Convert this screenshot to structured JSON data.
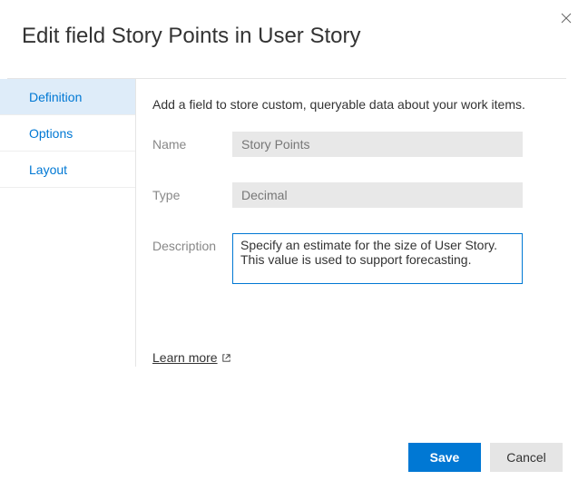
{
  "dialog": {
    "title": "Edit field Story Points in User Story"
  },
  "sidebar": {
    "items": [
      {
        "label": "Definition",
        "active": true
      },
      {
        "label": "Options",
        "active": false
      },
      {
        "label": "Layout",
        "active": false
      }
    ]
  },
  "main": {
    "helper_text": "Add a field to store custom, queryable data about your work items.",
    "fields": {
      "name_label": "Name",
      "name_value": "Story Points",
      "type_label": "Type",
      "type_value": "Decimal",
      "description_label": "Description",
      "description_value": "Specify an estimate for the size of User Story. This value is used to support forecasting."
    },
    "learn_more_label": "Learn more"
  },
  "footer": {
    "save_label": "Save",
    "cancel_label": "Cancel"
  }
}
